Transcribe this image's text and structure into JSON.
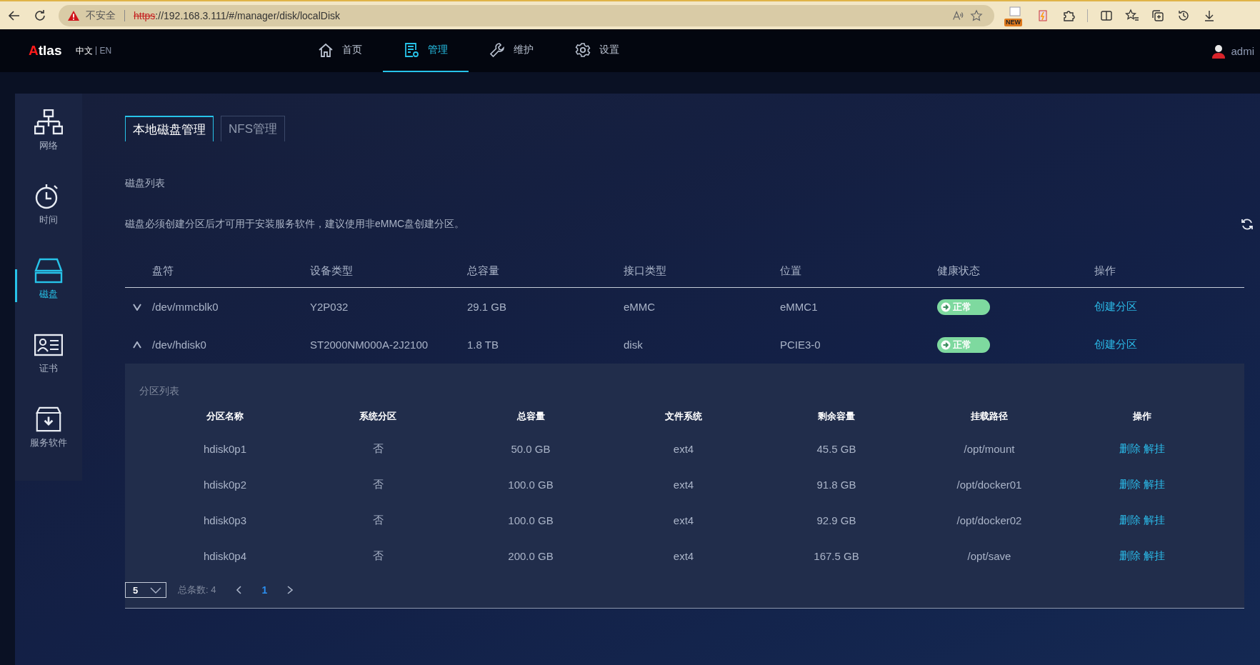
{
  "browser": {
    "security": "不安全",
    "url_scheme": "https",
    "url_rest": "://192.168.3.111/#/manager/disk/localDisk",
    "badge": "NEW"
  },
  "header": {
    "logo": {
      "initial": "A",
      "rest": "tlas"
    },
    "languages": [
      {
        "label": "中文",
        "selected": true
      },
      {
        "label": "EN",
        "selected": false
      }
    ],
    "nav": [
      {
        "label": "首页",
        "kind": "home",
        "selected": false
      },
      {
        "label": "管理",
        "kind": "manage",
        "selected": true
      },
      {
        "label": "维护",
        "kind": "wrench",
        "selected": false
      },
      {
        "label": "设置",
        "kind": "gear",
        "selected": false
      }
    ],
    "user": "admi"
  },
  "sidebar": {
    "items": [
      {
        "label": "网络",
        "kind": "network",
        "selected": false
      },
      {
        "label": "时间",
        "kind": "timer",
        "selected": false
      },
      {
        "label": "磁盘",
        "kind": "disk",
        "selected": true
      },
      {
        "label": "证书",
        "kind": "certificate",
        "selected": false
      },
      {
        "label": "服务软件",
        "kind": "package",
        "selected": false
      }
    ]
  },
  "tabs": [
    {
      "label": "本地磁盘管理",
      "selected": true
    },
    {
      "label": "NFS管理",
      "selected": false
    }
  ],
  "section_title": "磁盘列表",
  "note": "磁盘必须创建分区后才可用于安装服务软件，建议使用非eMMC盘创建分区。",
  "disk_table": {
    "columns": [
      "盘符",
      "设备类型",
      "总容量",
      "接口类型",
      "位置",
      "健康状态",
      "操作"
    ],
    "rows": [
      {
        "expanded": false,
        "cells": [
          "/dev/mmcblk0",
          "Y2P032",
          "29.1 GB",
          "eMMC",
          "eMMC1"
        ],
        "health": {
          "label": "正常",
          "color": "#7ed99f"
        },
        "action": "创建分区"
      },
      {
        "expanded": true,
        "cells": [
          "/dev/hdisk0",
          "ST2000NM000A-2J2100",
          "1.8 TB",
          "disk",
          "PCIE3-0"
        ],
        "health": {
          "label": "正常",
          "color": "#7ed99f"
        },
        "action": "创建分区",
        "partitions": {
          "title": "分区列表",
          "columns": [
            "分区名称",
            "系统分区",
            "总容量",
            "文件系统",
            "剩余容量",
            "挂载路径",
            "操作"
          ],
          "rows": [
            {
              "cells": [
                "hdisk0p1",
                "否",
                "50.0 GB",
                "ext4",
                "45.5 GB",
                "/opt/mount"
              ],
              "actions": [
                "删除",
                "解挂"
              ]
            },
            {
              "cells": [
                "hdisk0p2",
                "否",
                "100.0 GB",
                "ext4",
                "91.8 GB",
                "/opt/docker01"
              ],
              "actions": [
                "删除",
                "解挂"
              ]
            },
            {
              "cells": [
                "hdisk0p3",
                "否",
                "100.0 GB",
                "ext4",
                "92.9 GB",
                "/opt/docker02"
              ],
              "actions": [
                "删除",
                "解挂"
              ]
            },
            {
              "cells": [
                "hdisk0p4",
                "否",
                "200.0 GB",
                "ext4",
                "167.5 GB",
                "/opt/save"
              ],
              "actions": [
                "删除",
                "解挂"
              ]
            }
          ],
          "pagination": {
            "page_size": "5",
            "total": "总条数: 4",
            "pages": [
              {
                "label": "1",
                "selected": true
              }
            ]
          }
        }
      }
    ]
  }
}
